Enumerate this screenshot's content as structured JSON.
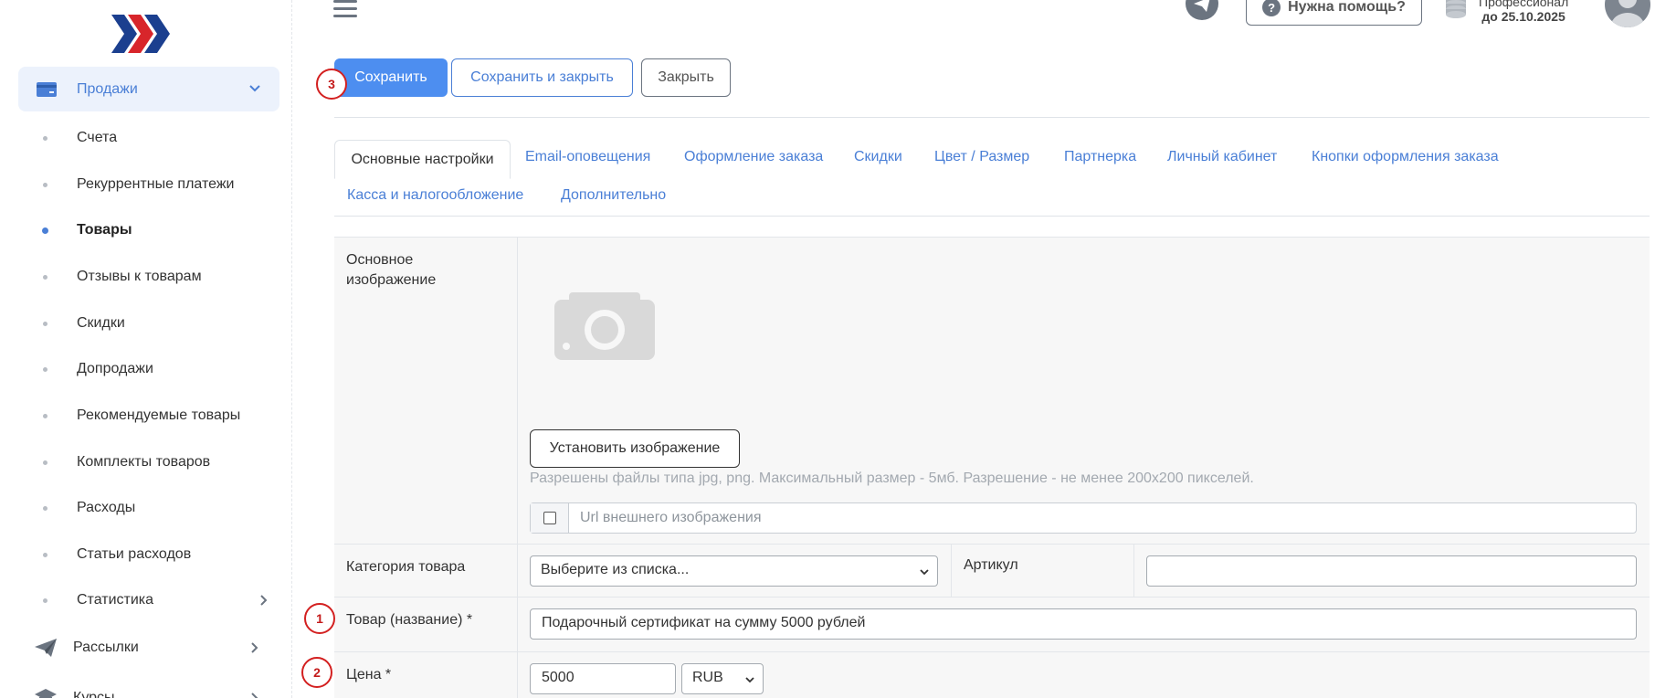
{
  "colors": {
    "accent": "#4d8ef0",
    "link": "#4a7fd6",
    "marker": "#d32020",
    "active_bg": "#ecf2fc"
  },
  "sidebar": {
    "logo": "brand-chevrons-logo",
    "sales_label": "Продажи",
    "items": [
      {
        "label": "Счета",
        "active": false
      },
      {
        "label": "Рекуррентные платежи",
        "active": false
      },
      {
        "label": "Товары",
        "active": true
      },
      {
        "label": "Отзывы к товарам",
        "active": false
      },
      {
        "label": "Скидки",
        "active": false
      },
      {
        "label": "Допродажи",
        "active": false
      },
      {
        "label": "Рекомендуемые товары",
        "active": false
      },
      {
        "label": "Комплекты товаров",
        "active": false
      },
      {
        "label": "Расходы",
        "active": false
      },
      {
        "label": "Статьи расходов",
        "active": false
      },
      {
        "label": "Статистика",
        "active": false
      }
    ],
    "mailing_label": "Рассылки",
    "courses_label": "Курсы"
  },
  "header": {
    "help_label": "Нужна помощь?",
    "plan_name": "Профессионал",
    "plan_until": "до 25.10.2025"
  },
  "actions": {
    "save": "Сохранить",
    "save_close": "Сохранить и закрыть",
    "close": "Закрыть"
  },
  "markers": {
    "save": "3",
    "name": "1",
    "price": "2"
  },
  "tabs": [
    "Основные настройки",
    "Email-оповещения",
    "Оформление заказа",
    "Скидки",
    "Цвет / Размер",
    "Партнерка",
    "Личный кабинет",
    "Кнопки оформления заказа",
    "Касса и налогообложение",
    "Дополнительно"
  ],
  "form": {
    "image_label": "Основное изображение",
    "set_image_button": "Установить изображение",
    "image_hint": "Разрешены файлы типа jpg, png. Максимальный размер - 5мб. Разрешение - не менее 200x200 пикселей.",
    "url_placeholder": "Url внешнего изображения",
    "category_label": "Категория товара",
    "category_value": "Выберите из списка...",
    "sku_label": "Артикул",
    "sku_value": "",
    "name_label": "Товар (название) *",
    "name_value": "Подарочный сертификат на сумму 5000 рублей",
    "price_label": "Цена *",
    "price_value": "5000",
    "currency_value": "RUB"
  }
}
